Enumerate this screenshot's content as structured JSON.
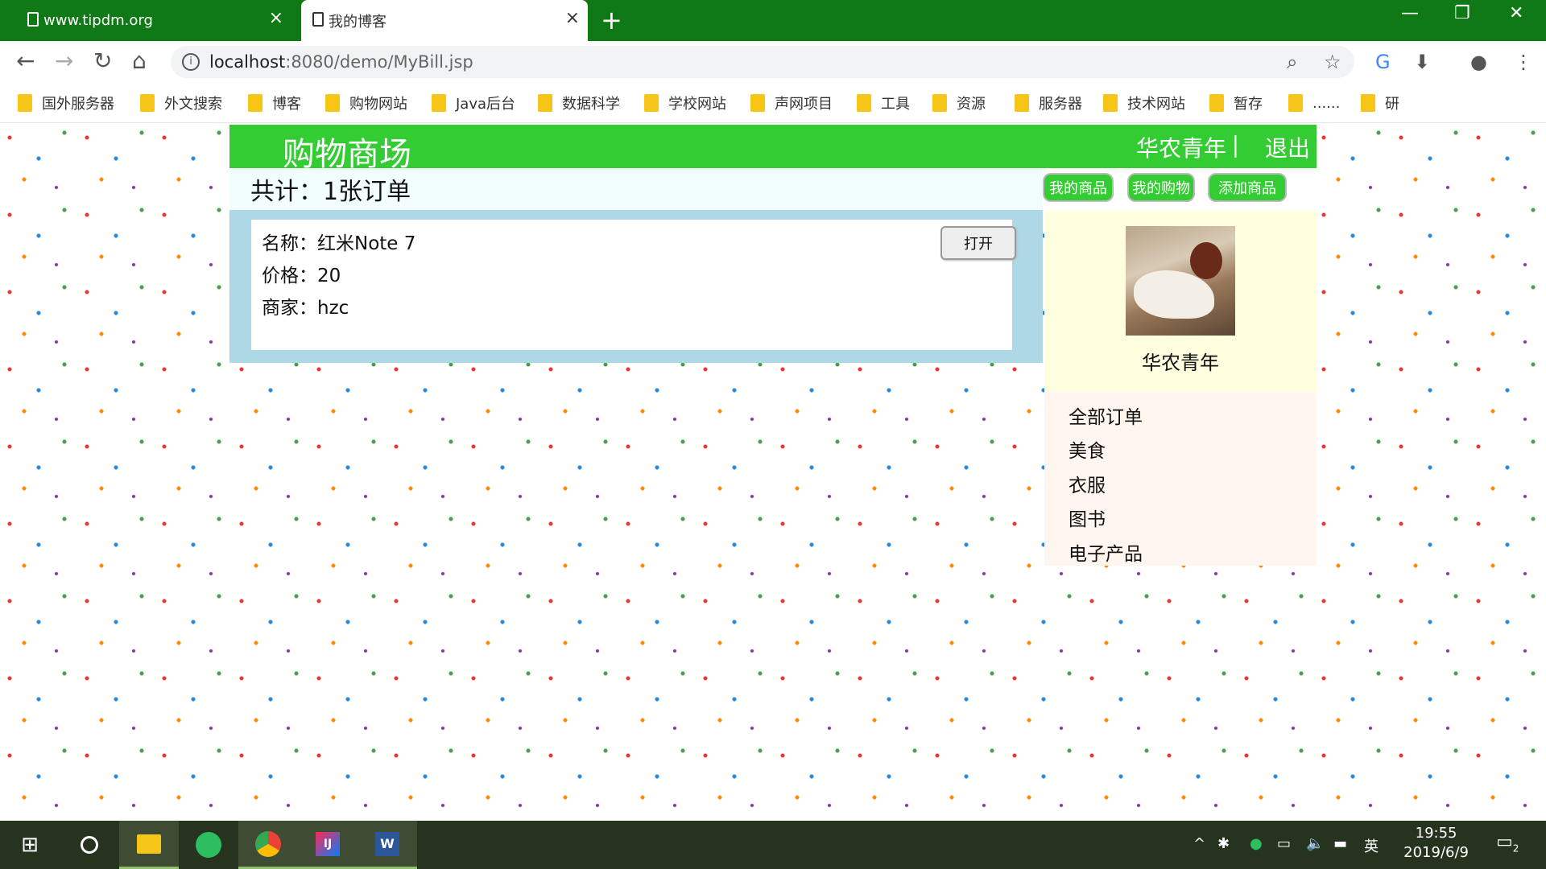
{
  "browser": {
    "tabs": [
      {
        "title": "www.tipdm.org",
        "active": false
      },
      {
        "title": "我的博客",
        "active": true
      }
    ],
    "url_host": "localhost",
    "url_rest": ":8080/demo/MyBill.jsp",
    "bookmarks": [
      "国外服务器",
      "外文搜索",
      "博客",
      "购物网站",
      "Java后台",
      "数据科学",
      "学校网站",
      "声网项目",
      "工具",
      "资源",
      "服务器",
      "技术网站",
      "暂存",
      "......",
      "研"
    ]
  },
  "site": {
    "title": "购物商场",
    "user": "华农青年",
    "separator": "|",
    "logout": "退出"
  },
  "summary": "共计：1张订单",
  "toolbar": {
    "my_goods": "我的商品",
    "my_shopping": "我的购物",
    "add_goods": "添加商品"
  },
  "order": {
    "name": "名称：红米Note 7",
    "price": "价格：20",
    "merchant": "商家：hzc",
    "open_label": "打开"
  },
  "profile": {
    "name": "华农青年"
  },
  "categories": [
    "全部订单",
    "美食",
    "衣服",
    "图书",
    "电子产品"
  ],
  "taskbar": {
    "time": "19:55",
    "date": "2019/6/9",
    "ime": "英",
    "notifications": "2"
  },
  "colors": {
    "chrome_green": "#0f7a15",
    "site_green": "#33cc33",
    "order_panel": "#add8e6",
    "profile_bg": "#ffffe0",
    "category_bg": "#fff6f0"
  }
}
